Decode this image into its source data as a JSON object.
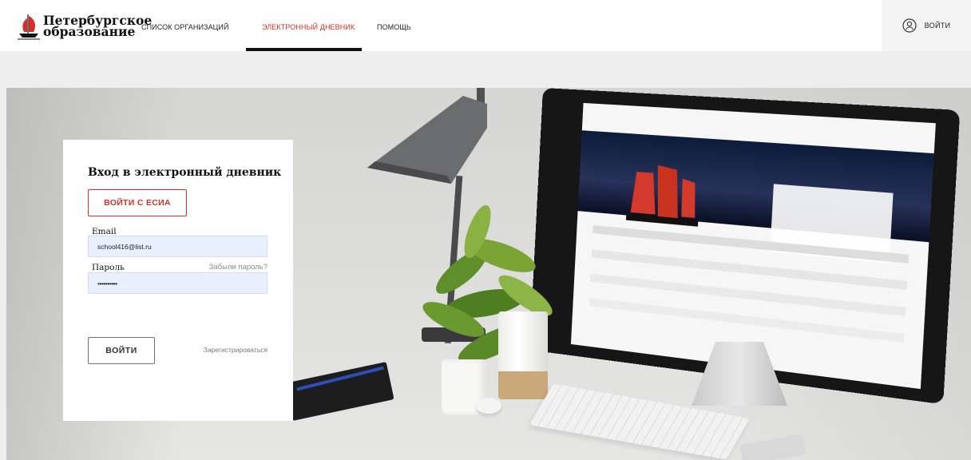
{
  "header": {
    "logo_line1": "Петербургское",
    "logo_line2": "образование",
    "nav": [
      {
        "label": "СПИСОК ОРГАНИЗАЦИЙ"
      },
      {
        "label": "ЭЛЕКТРОННЫЙ ДНЕВНИК",
        "active": true
      },
      {
        "label": "ПОМОЩЬ"
      }
    ],
    "login_label": "ВОЙТИ"
  },
  "login_form": {
    "title": "Вход в электронный дневник",
    "esia_button": "ВОЙТИ С ЕСИА",
    "email_label": "Email",
    "email_value": "school416@list.ru",
    "password_label": "Пароль",
    "password_value": "••••••••••",
    "forgot_link": "Забыли пароль?",
    "login_button": "ВОЙТИ",
    "register_link": "Зарегистрироваться"
  },
  "colors": {
    "accent": "#d2302b",
    "input_bg": "#e8f0fe",
    "header_bg": "#ffffff",
    "page_bg": "#eeeeee"
  },
  "icons": {
    "logo": "ship-logo-icon",
    "login": "user-icon"
  }
}
